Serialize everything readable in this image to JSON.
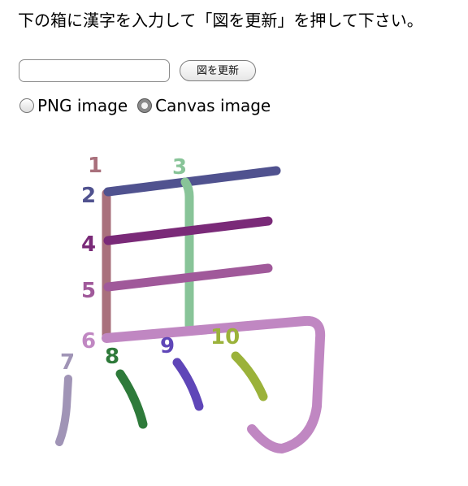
{
  "instruction_text": "下の箱に漢字を入力して「図を更新」を押して下さい。",
  "input": {
    "value": "",
    "placeholder": ""
  },
  "update_button_label": "図を更新",
  "image_mode": {
    "options": [
      {
        "label": "PNG image",
        "selected": false
      },
      {
        "label": "Canvas image",
        "selected": true
      }
    ]
  },
  "kanji_canvas": {
    "character": "馬",
    "strokes": [
      {
        "number": "1",
        "color": "#a9707c"
      },
      {
        "number": "2",
        "color": "#50528f"
      },
      {
        "number": "3",
        "color": "#88c498"
      },
      {
        "number": "4",
        "color": "#7a2a78"
      },
      {
        "number": "5",
        "color": "#a0599a"
      },
      {
        "number": "6",
        "color": "#c087c2"
      },
      {
        "number": "7",
        "color": "#a094b6"
      },
      {
        "number": "8",
        "color": "#2e7a3a"
      },
      {
        "number": "9",
        "color": "#5f46b8"
      },
      {
        "number": "10",
        "color": "#9bb23a"
      }
    ]
  }
}
